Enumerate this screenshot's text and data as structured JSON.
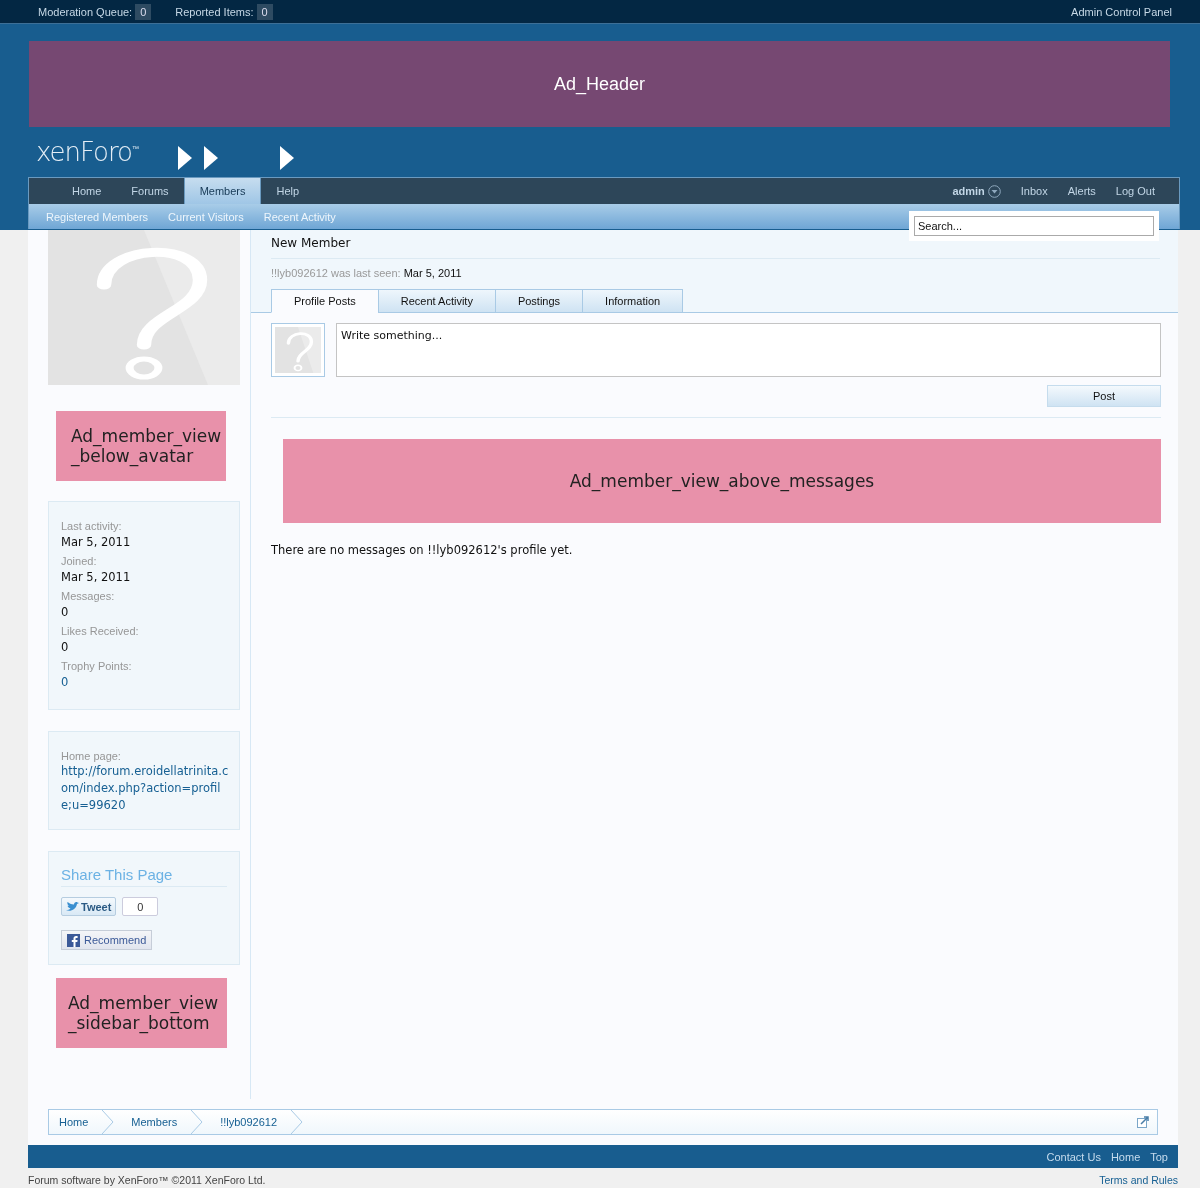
{
  "top_bar": {
    "items": [
      {
        "label": "Moderation Queue:",
        "count": "0"
      },
      {
        "label": "Reported Items:",
        "count": "0"
      }
    ],
    "right_link": "Admin Control Panel"
  },
  "header_ad": "Ad_Header",
  "logo": {
    "text": "xenForo",
    "mark": "™"
  },
  "nav": {
    "tabs": [
      {
        "label": "Home",
        "selected": false
      },
      {
        "label": "Forums",
        "selected": false
      },
      {
        "label": "Members",
        "selected": true
      },
      {
        "label": "Help",
        "selected": false
      }
    ],
    "user": "admin",
    "links": [
      "Inbox",
      "Alerts",
      "Log Out"
    ]
  },
  "subnav": [
    "Registered Members",
    "Current Visitors",
    "Recent Activity"
  ],
  "search": {
    "placeholder": "Search..."
  },
  "profile": {
    "title": "New Member",
    "last_seen_label": "!!lyb092612 was last seen:",
    "last_seen": "Mar 5, 2011"
  },
  "tabs": [
    {
      "label": "Profile Posts",
      "selected": true
    },
    {
      "label": "Recent Activity",
      "selected": false
    },
    {
      "label": "Postings",
      "selected": false
    },
    {
      "label": "Information",
      "selected": false
    }
  ],
  "status_box": {
    "placeholder": "Write something...",
    "button": "Post"
  },
  "ad_above_messages": "Ad_member_view_above_messages",
  "empty_message": "There are no messages on !!lyb092612's profile yet.",
  "sidebar": {
    "ad_below_avatar": [
      "Ad_member_view",
      "_below_avatar"
    ],
    "stats": [
      {
        "label": "Last activity:",
        "value": "Mar 5, 2011",
        "kind": "text"
      },
      {
        "label": "Joined:",
        "value": "Mar 5, 2011",
        "kind": "text"
      },
      {
        "label": "Messages:",
        "value": "0",
        "kind": "text"
      },
      {
        "label": "Likes Received:",
        "value": "0",
        "kind": "text"
      },
      {
        "label": "Trophy Points:",
        "value": "0",
        "kind": "link"
      }
    ],
    "home_page": {
      "label": "Home page:",
      "url": "http://forum.eroidellatrinita.com/index.php?action=profile;u=99620"
    },
    "share": {
      "title": "Share This Page",
      "tweet": "Tweet",
      "tweet_count": "0",
      "recommend": "Recommend"
    },
    "ad_bottom": [
      "Ad_member_view",
      "_sidebar_bottom"
    ]
  },
  "breadcrumb": [
    "Home",
    "Members",
    "!!lyb092612"
  ],
  "footer": {
    "links": [
      "Contact Us",
      "Home",
      "Top"
    ],
    "copyright": "Forum software by XenForo™ ©2011 XenForo Ltd.",
    "terms": "Terms and Rules"
  }
}
